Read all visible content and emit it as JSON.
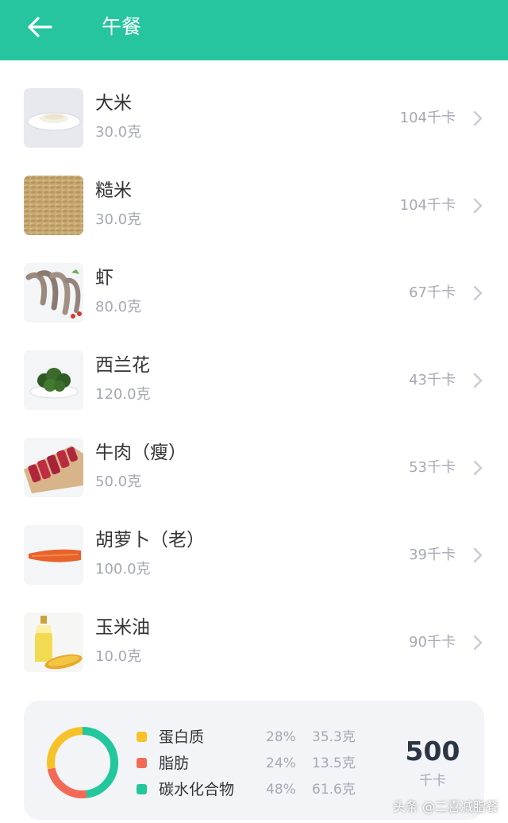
{
  "header": {
    "title": "午餐",
    "back_icon": "arrow-left-icon",
    "background": "#26c59f"
  },
  "foods": [
    {
      "name": "大米",
      "weight": "30.0克",
      "kcal": "104千卡",
      "image": "rice-bowl"
    },
    {
      "name": "糙米",
      "weight": "30.0克",
      "kcal": "104千卡",
      "image": "brown-rice-grains"
    },
    {
      "name": "虾",
      "weight": "80.0克",
      "kcal": "67千卡",
      "image": "shrimp"
    },
    {
      "name": "西兰花",
      "weight": "120.0克",
      "kcal": "43千卡",
      "image": "broccoli-plate"
    },
    {
      "name": "牛肉（瘦）",
      "weight": "50.0克",
      "kcal": "53千卡",
      "image": "beef-slices"
    },
    {
      "name": "胡萝卜（老）",
      "weight": "100.0克",
      "kcal": "39千卡",
      "image": "carrot"
    },
    {
      "name": "玉米油",
      "weight": "10.0克",
      "kcal": "90千卡",
      "image": "corn-oil-bottle"
    }
  ],
  "summary": {
    "macros": [
      {
        "name": "蛋白质",
        "percent": "28%",
        "grams": "35.3克",
        "color": "#f6c228",
        "fraction": 0.28
      },
      {
        "name": "脂肪",
        "percent": "24%",
        "grams": "13.5克",
        "color": "#f26a56",
        "fraction": 0.24
      },
      {
        "name": "碳水化合物",
        "percent": "48%",
        "grams": "61.6克",
        "color": "#22c79b",
        "fraction": 0.48
      }
    ],
    "total_kcal": "500",
    "total_unit": "千卡"
  },
  "watermark": "头条 @二喜减脂餐"
}
